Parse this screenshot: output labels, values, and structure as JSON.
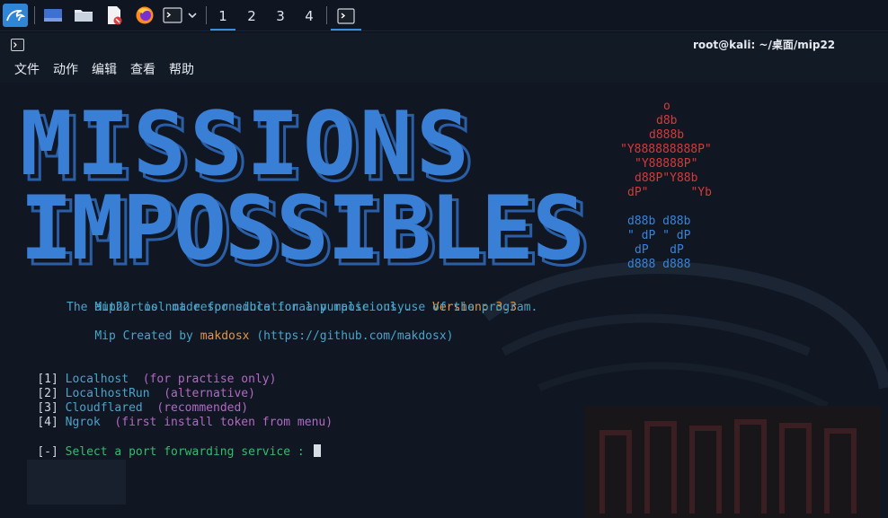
{
  "panel": {
    "workspaces": [
      "1",
      "2",
      "3",
      "4"
    ],
    "active_workspace": "1"
  },
  "window": {
    "title": "root@kali: ~/桌面/mip22"
  },
  "menu": [
    "文件",
    "动作",
    "编辑",
    "查看",
    "帮助"
  ],
  "banner": {
    "line1": "MISSIONS",
    "line2": "IMPOSSIBLES",
    "art_red": [
      "o",
      "d8b",
      "d888b",
      "\"Y888888888P\"",
      "\"Y88888P\"",
      "d88P\"Y88b",
      "dP\"      \"Yb"
    ],
    "art_blue": [
      "d88b d88b",
      "\" dP \" dP",
      "dP   dP",
      "d888 d888"
    ]
  },
  "info": {
    "line1_a": "Mip22 tool made for educational purpose only.",
    "version_label": "Version: 3.3",
    "line2": "The author is not responsible for any malicious use of the program.",
    "line3_a": "Mip Created by ",
    "author": "makdosx",
    "line3_b": " (https://github.com/makdosx)"
  },
  "options": [
    {
      "num": "[1]",
      "name": "Localhost",
      "note": "(for practise only)"
    },
    {
      "num": "[2]",
      "name": "LocalhostRun",
      "note": "(alternative)"
    },
    {
      "num": "[3]",
      "name": "Cloudflared",
      "note": "(recommended)"
    },
    {
      "num": "[4]",
      "name": "Ngrok",
      "note": "(first install token from menu)"
    }
  ],
  "prompt": {
    "prefix": "[-]",
    "text": "Select a port forwarding service :"
  },
  "colors": {
    "banner_blue": "#3a7fd6",
    "art_red": "#d23b3b",
    "art_blue": "#3a83d8",
    "info_cyan": "#4aa3c8",
    "version_orange": "#e59540",
    "note_magenta": "#b06ac0",
    "prompt_green": "#39b86b"
  }
}
